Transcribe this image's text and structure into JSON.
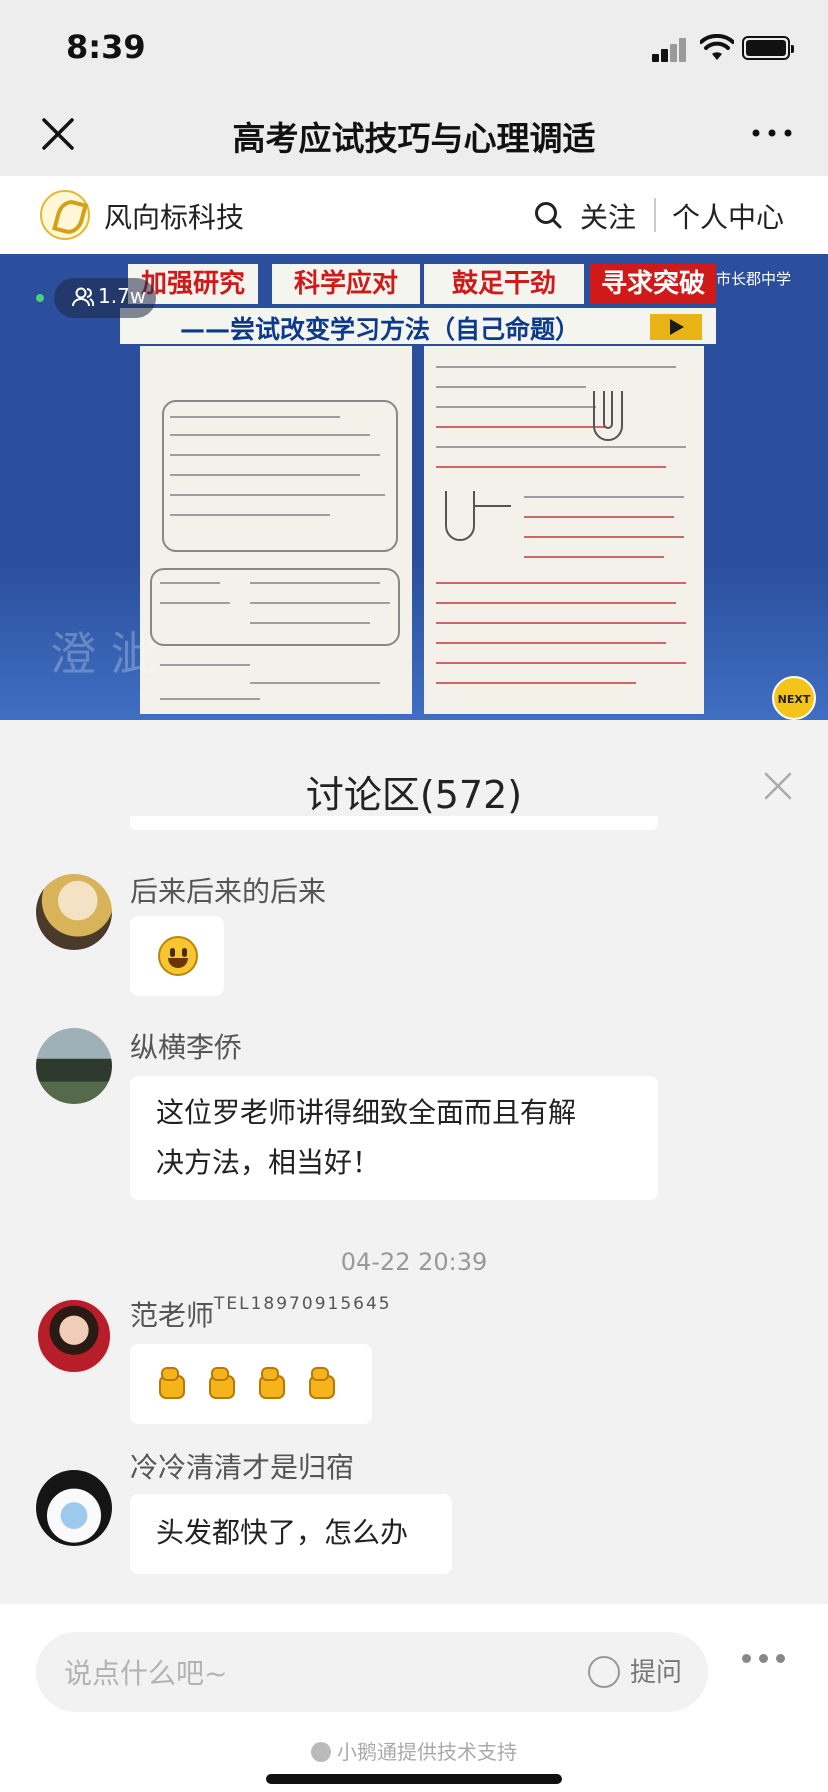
{
  "status_bar": {
    "time": "8:39"
  },
  "nav": {
    "title": "高考应试技巧与心理调适"
  },
  "channel": {
    "name": "风向标科技",
    "follow_label": "关注",
    "personal_label": "个人中心"
  },
  "video": {
    "viewer_count": "1.7w",
    "banners": [
      "加强研究",
      "科学应对",
      "鼓足干劲",
      "寻求突破"
    ],
    "subtitle": "——尝试改变学习方法（自己命题）",
    "school": "市长郡中学",
    "next_label": "NEXT",
    "watermark": "澄 泚"
  },
  "discussion": {
    "title": "讨论区(572)",
    "messages": [
      {
        "username": "后来后来的后来",
        "type": "emoji",
        "emoji": "smile"
      },
      {
        "username": "纵横李侨",
        "type": "text",
        "text_line1": "这位罗老师讲得细致全面而且有解",
        "text_line2": "决方法，相当好！"
      },
      {
        "timestamp": "04-22 20:39"
      },
      {
        "username": "范老师",
        "tel": "TEL18970915645",
        "type": "emoji",
        "emoji": "fist x4"
      },
      {
        "username": "冷冷清清才是归宿",
        "type": "text",
        "text_line1": "头发都快了，怎么办"
      }
    ]
  },
  "input": {
    "placeholder": "说点什么吧~",
    "ask_label": "提问"
  },
  "footer": {
    "support": "小鹅通提供技术支持"
  },
  "colors": {
    "accent_red": "#d01a1a",
    "video_blue": "#2b4f9c",
    "subtitle_blue": "#0b3a8c"
  }
}
